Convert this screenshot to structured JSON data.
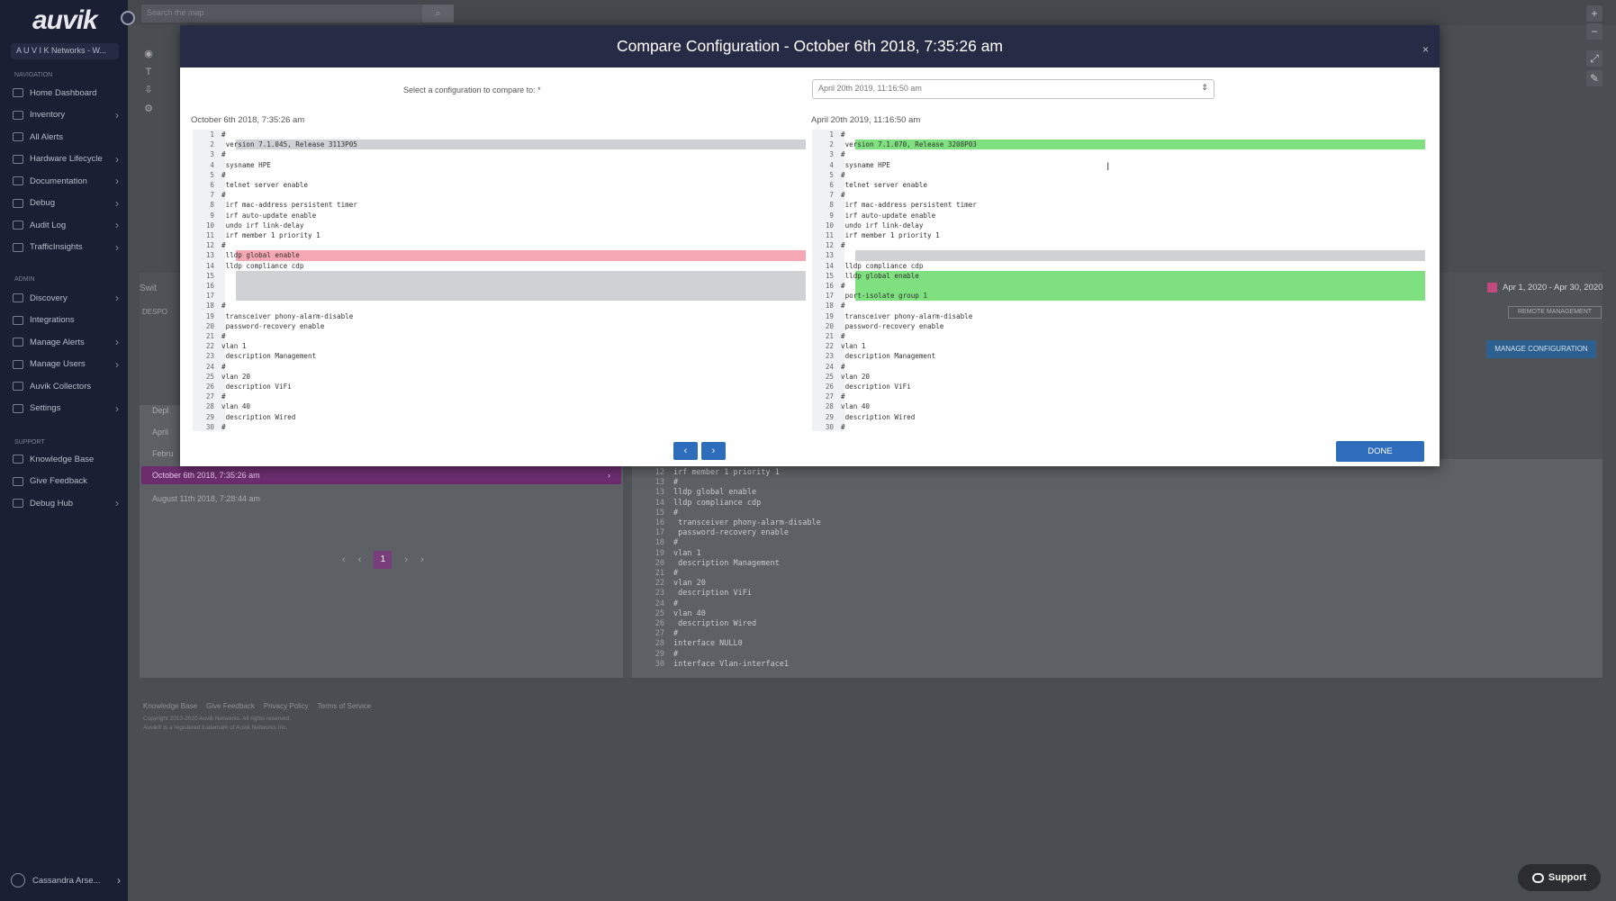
{
  "sidebar": {
    "logo": "auvik",
    "org": "A U V I K Networks - W...",
    "sections": {
      "navigation": "Navigation",
      "admin": "Admin",
      "support": "Support"
    },
    "nav_items": [
      {
        "label": "Home Dashboard",
        "chevron": false,
        "icon": "home-icon"
      },
      {
        "label": "Inventory",
        "chevron": true,
        "icon": "inventory-icon"
      },
      {
        "label": "All Alerts",
        "chevron": false,
        "icon": "alerts-icon"
      },
      {
        "label": "Hardware Lifecycle",
        "chevron": true,
        "icon": "hardware-icon"
      },
      {
        "label": "Documentation",
        "chevron": true,
        "icon": "documentation-icon"
      },
      {
        "label": "Debug",
        "chevron": true,
        "icon": "debug-icon"
      },
      {
        "label": "Audit Log",
        "chevron": true,
        "icon": "audit-log-icon"
      },
      {
        "label": "TrafficInsights",
        "chevron": true,
        "icon": "traffic-icon"
      }
    ],
    "admin_items": [
      {
        "label": "Discovery",
        "chevron": true,
        "icon": "discovery-icon"
      },
      {
        "label": "Integrations",
        "chevron": false,
        "icon": "integrations-icon"
      },
      {
        "label": "Manage Alerts",
        "chevron": true,
        "icon": "manage-alerts-icon"
      },
      {
        "label": "Manage Users",
        "chevron": true,
        "icon": "manage-users-icon"
      },
      {
        "label": "Auvik Collectors",
        "chevron": false,
        "icon": "collectors-icon"
      },
      {
        "label": "Settings",
        "chevron": true,
        "icon": "settings-icon"
      }
    ],
    "support_items": [
      {
        "label": "Knowledge Base",
        "chevron": false,
        "icon": "knowledge-icon"
      },
      {
        "label": "Give Feedback",
        "chevron": false,
        "icon": "feedback-icon"
      },
      {
        "label": "Debug Hub",
        "chevron": true,
        "icon": "debug-hub-icon"
      }
    ],
    "user": "Cassandra Arse..."
  },
  "background": {
    "search_placeholder": "Search the map",
    "date_range": "Apr 1, 2020 - Apr 30, 2020",
    "remote_management": "REMOTE MANAGEMENT",
    "manage_configuration": "MANAGE CONFIGURATION",
    "side_label": "Swit",
    "side_label2": "DESPO",
    "rows": [
      "Depl",
      "April",
      "Febru",
      "October 6th 2018, 7:35:26 am",
      "August 11th 2018, 7:28:44 am"
    ],
    "pager": {
      "prev": "‹",
      "first": "‹",
      "current": "1",
      "next": "›",
      "last": "›"
    },
    "code_lines": [
      {
        "n": "12",
        "t": "irf member 1 priority 1"
      },
      {
        "n": "13",
        "t": "#"
      },
      {
        "n": "13",
        "t": "lldp global enable"
      },
      {
        "n": "14",
        "t": "lldp compliance cdp"
      },
      {
        "n": "15",
        "t": "#"
      },
      {
        "n": "16",
        "t": " transceiver phony-alarm-disable"
      },
      {
        "n": "17",
        "t": " password-recovery enable"
      },
      {
        "n": "18",
        "t": "#"
      },
      {
        "n": "19",
        "t": "vlan 1"
      },
      {
        "n": "20",
        "t": " description Management"
      },
      {
        "n": "21",
        "t": "#"
      },
      {
        "n": "22",
        "t": "vlan 20"
      },
      {
        "n": "23",
        "t": " description ViFi"
      },
      {
        "n": "24",
        "t": "#"
      },
      {
        "n": "25",
        "t": "vlan 40"
      },
      {
        "n": "26",
        "t": " description Wired"
      },
      {
        "n": "27",
        "t": "#"
      },
      {
        "n": "28",
        "t": "interface NULL0"
      },
      {
        "n": "29",
        "t": "#"
      },
      {
        "n": "30",
        "t": "interface Vlan-interface1"
      }
    ],
    "footer_links": [
      "Knowledge Base",
      "Give Feedback",
      "Privacy Policy",
      "Terms of Service"
    ],
    "footer_copy": [
      "Copyright 2013-2020 Auvik Networks. All rights reserved.",
      "Auvik® is a registered trademark of Auvik Networks Inc."
    ],
    "support_label": "Support"
  },
  "modal": {
    "title": "Compare Configuration - October 6th 2018, 7:35:26 am",
    "close": "×",
    "select_label": "Select a configuration to compare to: *",
    "select_value": "April 20th 2019, 11:16:50 am",
    "left_title": "October 6th 2018, 7:35:26 am",
    "right_title": "April 20th 2019, 11:16:50 am",
    "prev_label": "‹",
    "next_label": "›",
    "done_label": "DONE",
    "left_lines": [
      {
        "n": "1",
        "t": "#",
        "hl": ""
      },
      {
        "n": "2",
        "t": " version 7.1.045, Release 3113P05",
        "hl": "gray"
      },
      {
        "n": "3",
        "t": "#",
        "hl": ""
      },
      {
        "n": "4",
        "t": " sysname HPE",
        "hl": ""
      },
      {
        "n": "5",
        "t": "#",
        "hl": ""
      },
      {
        "n": "6",
        "t": " telnet server enable",
        "hl": ""
      },
      {
        "n": "7",
        "t": "#",
        "hl": ""
      },
      {
        "n": "8",
        "t": " irf mac-address persistent timer",
        "hl": ""
      },
      {
        "n": "9",
        "t": " irf auto-update enable",
        "hl": ""
      },
      {
        "n": "10",
        "t": " undo irf link-delay",
        "hl": ""
      },
      {
        "n": "11",
        "t": " irf member 1 priority 1",
        "hl": ""
      },
      {
        "n": "12",
        "t": "#",
        "hl": ""
      },
      {
        "n": "13",
        "t": " lldp global enable",
        "hl": "red"
      },
      {
        "n": "14",
        "t": " lldp compliance cdp",
        "hl": ""
      },
      {
        "n": "15",
        "t": "",
        "hl": "gray"
      },
      {
        "n": "16",
        "t": "",
        "hl": "gray"
      },
      {
        "n": "17",
        "t": "",
        "hl": "gray"
      },
      {
        "n": "18",
        "t": "#",
        "hl": ""
      },
      {
        "n": "19",
        "t": " transceiver phony-alarm-disable",
        "hl": ""
      },
      {
        "n": "20",
        "t": " password-recovery enable",
        "hl": ""
      },
      {
        "n": "21",
        "t": "#",
        "hl": ""
      },
      {
        "n": "22",
        "t": "vlan 1",
        "hl": ""
      },
      {
        "n": "23",
        "t": " description Management",
        "hl": ""
      },
      {
        "n": "24",
        "t": "#",
        "hl": ""
      },
      {
        "n": "25",
        "t": "vlan 20",
        "hl": ""
      },
      {
        "n": "26",
        "t": " description ViFi",
        "hl": ""
      },
      {
        "n": "27",
        "t": "#",
        "hl": ""
      },
      {
        "n": "28",
        "t": "vlan 40",
        "hl": ""
      },
      {
        "n": "29",
        "t": " description Wired",
        "hl": ""
      },
      {
        "n": "30",
        "t": "#",
        "hl": ""
      }
    ],
    "right_lines": [
      {
        "n": "1",
        "t": "#",
        "hl": ""
      },
      {
        "n": "2",
        "t": " version 7.1.070, Release 3208P03",
        "hl": "green"
      },
      {
        "n": "3",
        "t": "#",
        "hl": ""
      },
      {
        "n": "4",
        "t": " sysname HPE",
        "hl": ""
      },
      {
        "n": "5",
        "t": "#",
        "hl": ""
      },
      {
        "n": "6",
        "t": " telnet server enable",
        "hl": ""
      },
      {
        "n": "7",
        "t": "#",
        "hl": ""
      },
      {
        "n": "8",
        "t": " irf mac-address persistent timer",
        "hl": ""
      },
      {
        "n": "9",
        "t": " irf auto-update enable",
        "hl": ""
      },
      {
        "n": "10",
        "t": " undo irf link-delay",
        "hl": ""
      },
      {
        "n": "11",
        "t": " irf member 1 priority 1",
        "hl": ""
      },
      {
        "n": "12",
        "t": "#",
        "hl": ""
      },
      {
        "n": "13",
        "t": "",
        "hl": "gray"
      },
      {
        "n": "14",
        "t": " lldp compliance cdp",
        "hl": ""
      },
      {
        "n": "15",
        "t": " lldp global enable",
        "hl": "green"
      },
      {
        "n": "16",
        "t": "#",
        "hl": "green"
      },
      {
        "n": "17",
        "t": " port-isolate group 1",
        "hl": "green"
      },
      {
        "n": "18",
        "t": "#",
        "hl": ""
      },
      {
        "n": "19",
        "t": " transceiver phony-alarm-disable",
        "hl": ""
      },
      {
        "n": "20",
        "t": " password-recovery enable",
        "hl": ""
      },
      {
        "n": "21",
        "t": "#",
        "hl": ""
      },
      {
        "n": "22",
        "t": "vlan 1",
        "hl": ""
      },
      {
        "n": "23",
        "t": " description Management",
        "hl": ""
      },
      {
        "n": "24",
        "t": "#",
        "hl": ""
      },
      {
        "n": "25",
        "t": "vlan 20",
        "hl": ""
      },
      {
        "n": "26",
        "t": " description ViFi",
        "hl": ""
      },
      {
        "n": "27",
        "t": "#",
        "hl": ""
      },
      {
        "n": "28",
        "t": "vlan 40",
        "hl": ""
      },
      {
        "n": "29",
        "t": " description Wired",
        "hl": ""
      },
      {
        "n": "30",
        "t": "#",
        "hl": ""
      }
    ]
  },
  "colors": {
    "sidebar_bg": "#1b1f33",
    "modal_header": "#272b45",
    "diff_removed": "#f6a7b4",
    "diff_added": "#7ee07e",
    "diff_changed": "#cfd1d4",
    "primary_button": "#2e6cbc",
    "active_row": "#6c2d6e"
  }
}
